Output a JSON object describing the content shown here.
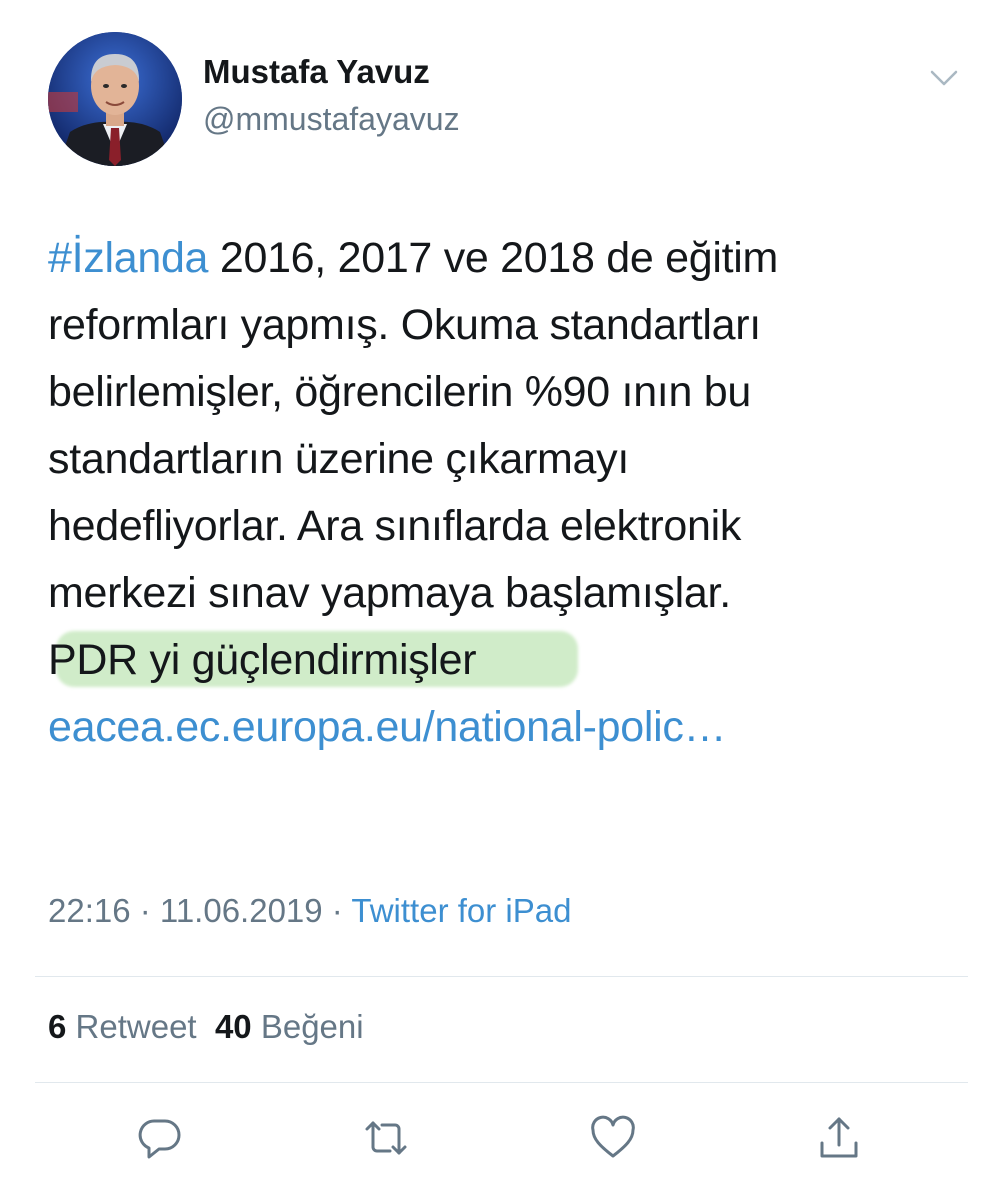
{
  "author": {
    "display_name": "Mustafa Yavuz",
    "handle": "@mmustafayavuz"
  },
  "tweet": {
    "hashtag": "#İzlanda",
    "lines": [
      " 2016, 2017 ve 2018 de eğitim",
      "reformları yapmış. Okuma standartları",
      "belirlemişler, öğrencilerin %90 ının bu",
      "standartların üzerine çıkarmayı",
      "hedefliyorlar. Ara sınıflarda elektronik",
      "merkezi sınav yapmaya başlamışlar."
    ],
    "highlighted_line": "PDR yi güçlendirmişler",
    "link": "eacea.ec.europa.eu/national-polic…"
  },
  "meta": {
    "time": "22:16",
    "separator": " · ",
    "date": "11.06.2019",
    "source": "Twitter for iPad"
  },
  "stats": {
    "retweets_count": "6",
    "retweets_label": " Retweet",
    "likes_count": "40",
    "likes_label": " Beğeni"
  },
  "icons": {
    "caret": "chevron-down-icon",
    "reply": "reply-icon",
    "retweet": "retweet-icon",
    "like": "heart-icon",
    "share": "share-icon"
  },
  "colors": {
    "link": "#3d8fd1",
    "text": "#14171a",
    "secondary": "#657786",
    "highlight": "#a7dd9a",
    "divider": "#e1e8ed"
  }
}
